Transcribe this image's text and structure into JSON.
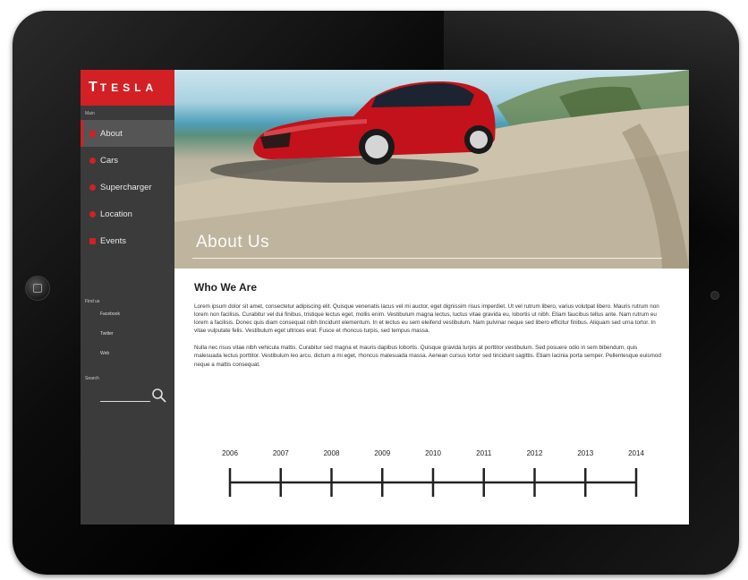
{
  "brand": {
    "name": "TESLA",
    "logo_icon": "tesla-t-logo",
    "accent": "#d32024"
  },
  "sidebar": {
    "menu_label": "Main",
    "items": [
      {
        "label": "About",
        "icon": "square-icon",
        "active": true
      },
      {
        "label": "Cars",
        "icon": "circle-icon"
      },
      {
        "label": "Supercharger",
        "icon": "pin-icon"
      },
      {
        "label": "Location",
        "icon": "location-icon"
      },
      {
        "label": "Events",
        "icon": "square-icon"
      }
    ],
    "find_label": "Find us",
    "social": [
      "Facebook",
      "Twitter",
      "Web"
    ],
    "search_label": "Search"
  },
  "hero": {
    "title": "About Us"
  },
  "main": {
    "heading": "Who We Are",
    "paragraph1": "Lorem ipsum dolor sit amet, consectetur adipiscing elit. Quisque venenatis lacus vel mi auctor, eget dignissim risus imperdiet. Ut vel rutrum libero, varius volutpat libero. Mauris rutrum non lorem non facilisis. Curabitur vel dui finibus, tristique lectus eget, mollis enim. Vestibulum magna lectus, luctus vitae gravida eu, lobortis ut nibh. Etiam faucibus tellus ante. Nam rutrum eu lorem a facilisis. Donec quis diam consequat nibh tincidunt elementum. In et lectus eu sem eleifend vestibulum. Nam pulvinar neque sed libero efficitur finibus. Aliquam sed urna tortor. In vitae vulputate felis. Vestibulum eget ultrices erat. Fusce et rhoncus turpis, sed tempus massa.",
    "paragraph2": "Nulla nec risus vitae nibh vehicula mattis. Curabitur sed magna et mauris dapibus lobortis. Quisque gravida turpis at porttitor vestibulum. Sed posuere odio in sem bibendum, quis malesuada lectus porttitor. Vestibulum leo arcu, dictum a mi eget, rhoncus malesuada massa. Aenean cursus tortor sed tincidunt sagittis. Etiam lacinia porta semper. Pellentesque euismod neque a mattis consequat."
  },
  "timeline": {
    "years": [
      "2006",
      "2007",
      "2008",
      "2009",
      "2010",
      "2011",
      "2012",
      "2013",
      "2014"
    ]
  }
}
